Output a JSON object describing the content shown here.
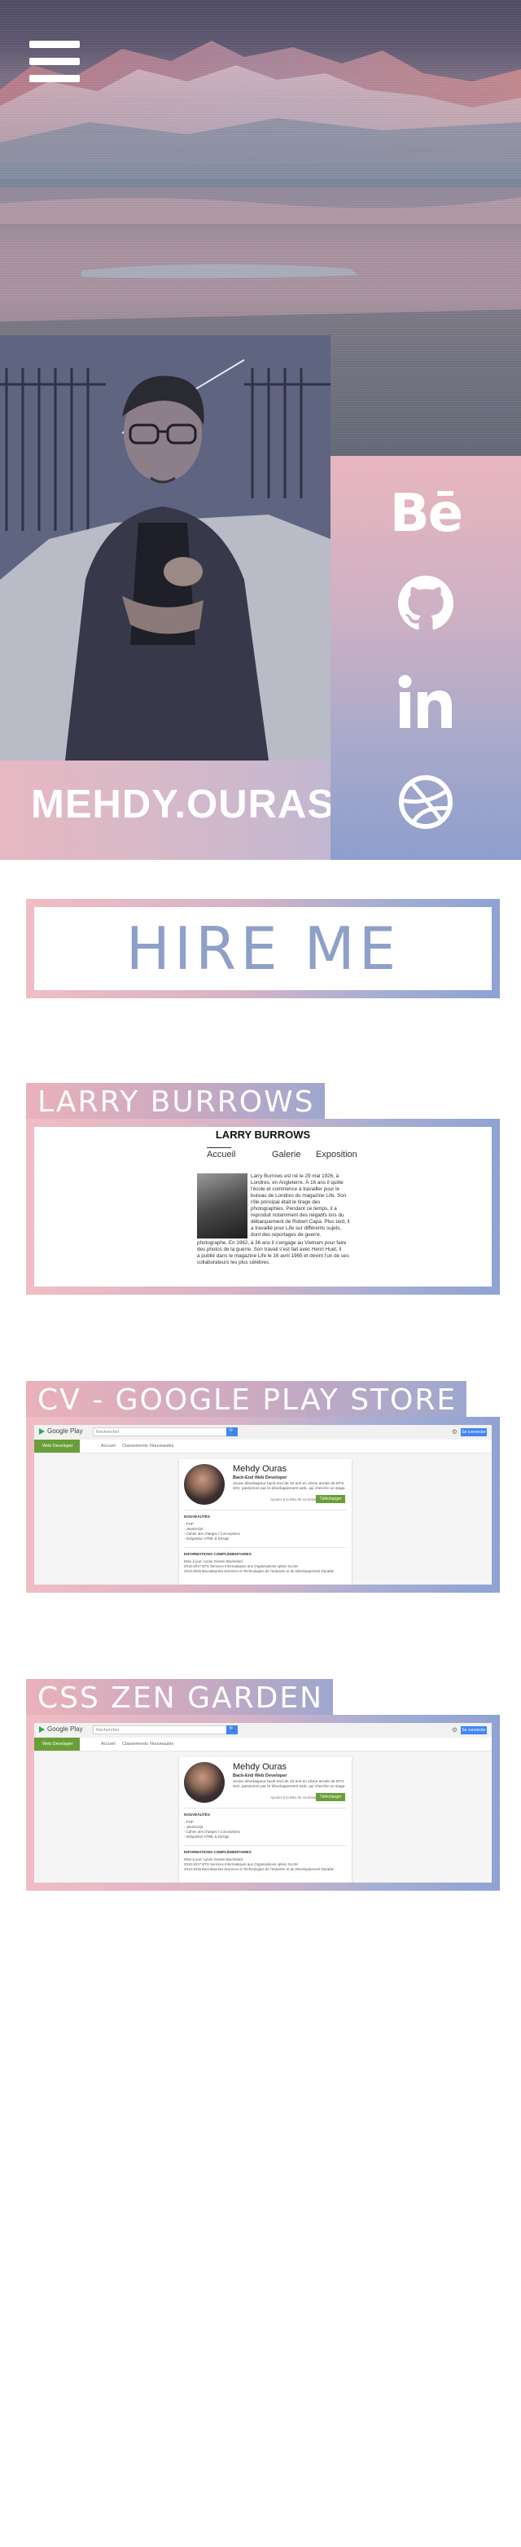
{
  "header": {
    "menu_icon": "hamburger-menu-icon"
  },
  "profile": {
    "name": "MEHDY.OURAS",
    "social": [
      {
        "name": "behance",
        "label": "Bē"
      },
      {
        "name": "github",
        "icon": "github-icon"
      },
      {
        "name": "linkedin",
        "label": "in"
      },
      {
        "name": "dribbble",
        "icon": "dribbble-icon"
      }
    ]
  },
  "hire": {
    "label": "HIRE ME"
  },
  "projects": [
    {
      "title": "LARRY BURROWS",
      "preview": {
        "heading": "LARRY BURROWS",
        "nav": [
          "Accueil",
          "Galerie",
          "Exposition"
        ],
        "text_wrapped": [
          "Larry Burrows est né le 29 mai 1926, à",
          "Londres, en Angleterre. À 16 ans il quitte",
          "l'école et commence à travailler pour le",
          "bureau de Londres du magazine Life. Son",
          "rôle principal était le tirage des",
          "photographies. Pendant ce temps, il a",
          "reproduit notamment des négatifs lors du",
          "débarquement de Robert Capa. Plus tard, il",
          "a travaillé pour Life sur différents sujets,",
          "dont des reportages de guerre."
        ],
        "text_full": [
          "photographe. En 1962, à 36 ans il s'engage au Vietnam pour faire",
          "des photos de la guerre. Son travail s'est fait avec Henri Huet, il",
          "a publié dans le magazine Life le 16 avril 1965 et devint l'un de ses",
          "collaborateurs les plus célèbres."
        ]
      }
    },
    {
      "title": "CV - GOOGLE PLAY STORE",
      "preview": {
        "store_name": "Google Play",
        "search_placeholder": "Rechercher",
        "search_button": "🔍",
        "signin": "Se connecter",
        "category": "Web Developer",
        "tabs": [
          "Accueil",
          "Classements",
          "Nouveautés"
        ],
        "app_name": "Mehdy Ouras",
        "app_subtitle": "Back-End Web Developer",
        "app_desc": "Jeune développeur back-end de 19 ans en 2ème année de BTS SIO, passionné par le développement web, qui cherche un stage.",
        "wishlist": "Ajouter à la liste de souhaits",
        "download": "Télécharger",
        "section1": "NOUVEAUTÉS",
        "items1": [
          "- PHP",
          "- JavaScript",
          "- Cahier des charges / Conceptions",
          "- Intégration HTML & Design"
        ],
        "section2": "INFORMATIONS COMPLÉMENTAIRES",
        "items2": [
          "Mise à jour: Lycée Gaston Bachelard",
          "2016-2017 BTS Services Informatiques aux Organisations option SLAM",
          "2013-2016 Baccalauréat Sciences et Technologies de l'Industrie et du Développement Durable"
        ]
      }
    },
    {
      "title": "CSS ZEN GARDEN",
      "preview": {
        "store_name": "Google Play",
        "search_placeholder": "Rechercher",
        "search_button": "🔍",
        "signin": "Se connecter",
        "category": "Web Developer",
        "tabs": [
          "Accueil",
          "Classements",
          "Nouveautés"
        ],
        "app_name": "Mehdy Ouras",
        "app_subtitle": "Back-End Web Developer",
        "app_desc": "Jeune développeur back-end de 19 ans en 2ème année de BTS SIO, passionné par le développement web, qui cherche un stage.",
        "wishlist": "Ajouter à la liste de souhaits",
        "download": "Télécharger",
        "section1": "NOUVEAUTÉS",
        "items1": [
          "- PHP",
          "- JavaScript",
          "- Cahier des charges / Conceptions",
          "- Intégration HTML & Design"
        ],
        "section2": "INFORMATIONS COMPLÉMENTAIRES",
        "items2": [
          "Mise à jour: Lycée Gaston Bachelard",
          "2016-2017 BTS Services Informatiques aux Organisations option SLAM",
          "2013-2016 Baccalauréat Sciences et Technologies de l'Industrie et du Développement Durable"
        ]
      }
    }
  ]
}
